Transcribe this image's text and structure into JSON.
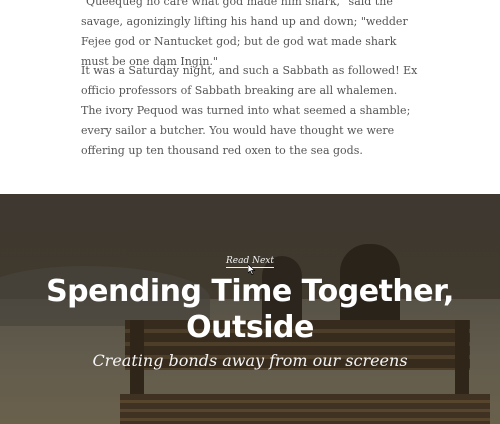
{
  "article": {
    "paragraph1": "\"Queequeg no care what god made him shark,\" said the savage, agonizingly lifting his hand up and down; \"wedder Fejee god or Nantucket god; but de god wat made shark must be one dam Ingin.\"",
    "paragraph2": "It was a Saturday night, and such a Sabbath as followed! Ex officio professors of Sabbath breaking are all whalemen. The ivory Pequod was turned into what seemed a shamble; every sailor a butcher. You would have thought we were offering up ten thousand red oxen to the sea gods."
  },
  "next_post": {
    "read_next_label": "Read Next",
    "title": "Spending Time Together, Outside",
    "subtitle": "Creating bonds away from our screens"
  }
}
